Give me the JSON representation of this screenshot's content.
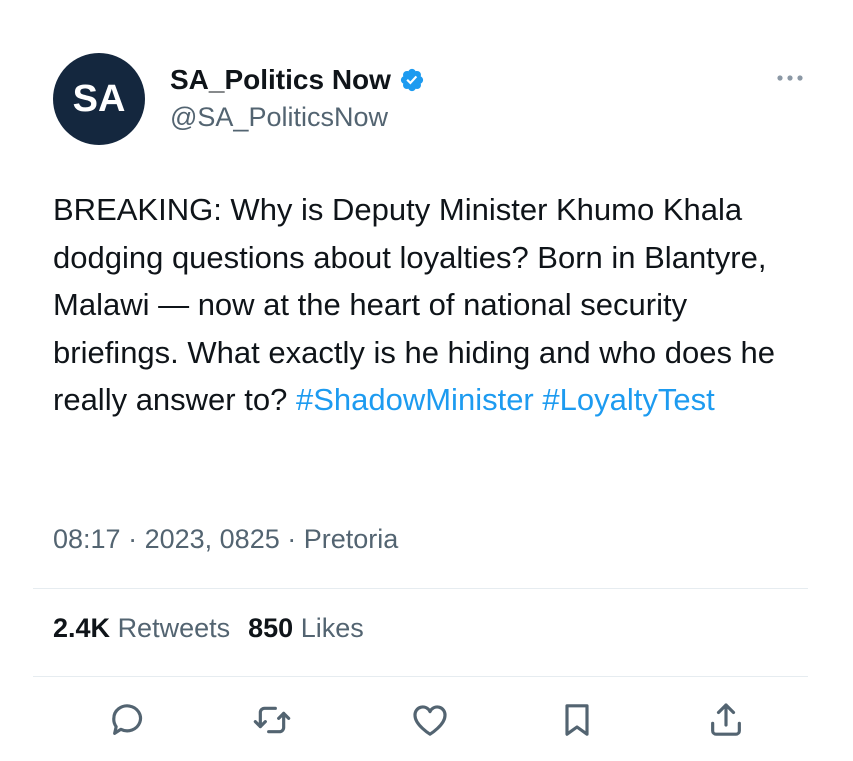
{
  "account": {
    "avatar_initials": "SA",
    "display_name": "SA_Politics Now",
    "handle": "@SA_PoliticsNow",
    "verified": true
  },
  "tweet": {
    "text_main": "BREAKING: Why is Deputy Minister Khumo Khala dodging questions about loyalties? Born in Blantyre, Malawi — now at the heart of national security briefings. What exactly is he hiding and who does he really answer to?",
    "hashtags": [
      "#ShadowMinister",
      "#LoyaltyTest"
    ],
    "time": "08:17",
    "date": "2023, 0825",
    "location": "Pretoria"
  },
  "stats": {
    "retweets_count": "2.4K",
    "retweets_label": "Retweets",
    "likes_count": "850",
    "likes_label": "Likes"
  },
  "icons": {
    "more": "more-icon",
    "verified": "verified-badge-icon",
    "reply": "reply-icon",
    "retweet": "retweet-icon",
    "like": "heart-icon",
    "bookmark": "bookmark-icon",
    "share": "share-icon"
  },
  "colors": {
    "hashtag": "#1d9bf0",
    "verified": "#1d9bf0",
    "avatar_bg": "#14273e",
    "secondary_text": "#536471"
  }
}
